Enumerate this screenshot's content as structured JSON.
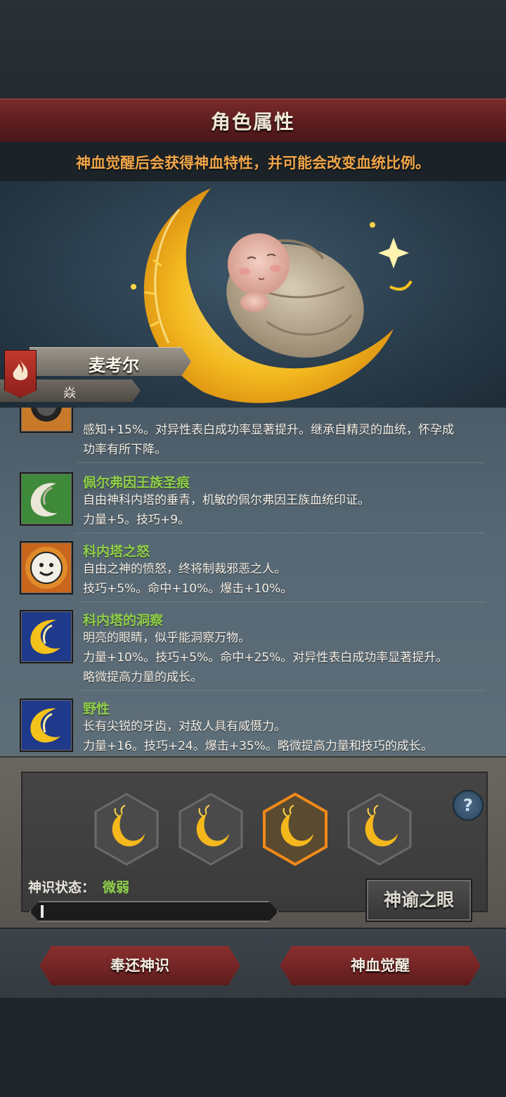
{
  "header": {
    "title": "角色属性",
    "hint": "神血觉醒后会获得神血特性，并可能会改变血统比例。"
  },
  "character": {
    "name": "麦考尔",
    "sub_label": "焱",
    "flag_icon": "flame-icon"
  },
  "traits": [
    {
      "name": "",
      "desc_lines": [
        "感知+15%。对异性表白成功率显著提升。继承自精灵的血统，怀孕成",
        "功率有所下降。"
      ],
      "icon": "sun-orb-icon",
      "icon_bg": "#c87a2a"
    },
    {
      "name": "佩尔弗因王族圣痕",
      "desc_lines": [
        "自由神科内塔的垂青，机敏的佩尔弗因王族血统印证。",
        "力量+5。技巧+9。"
      ],
      "icon": "white-crescent-icon",
      "icon_bg": "#3f8a3a"
    },
    {
      "name": "科内塔之怒",
      "desc_lines": [
        "自由之神的愤怒，终将制裁邪恶之人。",
        "技巧+5%。命中+10%。爆击+10%。"
      ],
      "icon": "smiling-sun-icon",
      "icon_bg": "#c8661e"
    },
    {
      "name": "科内塔的洞察",
      "desc_lines": [
        "明亮的眼睛，似乎能洞察万物。",
        "力量+10%。技巧+5%。命中+25%。对异性表白成功率显著提升。",
        "略微提高力量的成长。"
      ],
      "icon": "gold-crescent-icon",
      "icon_bg": "#1f3a8a"
    },
    {
      "name": "野性",
      "desc_lines": [
        "长有尖锐的牙齿，对敌人具有威慑力。",
        "力量+16。技巧+24。爆击+35%。略微提高力量和技巧的成长。"
      ],
      "icon": "gold-crescent-icon",
      "icon_bg": "#1f3a8a"
    }
  ],
  "divine_sense": {
    "slots": [
      {
        "icon": "moon-slot-icon",
        "selected": false
      },
      {
        "icon": "moon-slot-icon",
        "selected": false
      },
      {
        "icon": "moon-slot-icon",
        "selected": true
      },
      {
        "icon": "moon-slot-icon",
        "selected": false
      }
    ],
    "help_label": "?",
    "status_label": "神识状态：",
    "status_value": "微弱",
    "progress": 0.02,
    "eye_button": "神谕之眼"
  },
  "actions": {
    "return_label": "奉还神识",
    "awaken_label": "神血觉醒"
  },
  "colors": {
    "accent_red": "#7a2a2a",
    "hint_orange": "#f0a64a",
    "trait_green": "#8fd04a",
    "gold": "#f5b81c"
  }
}
